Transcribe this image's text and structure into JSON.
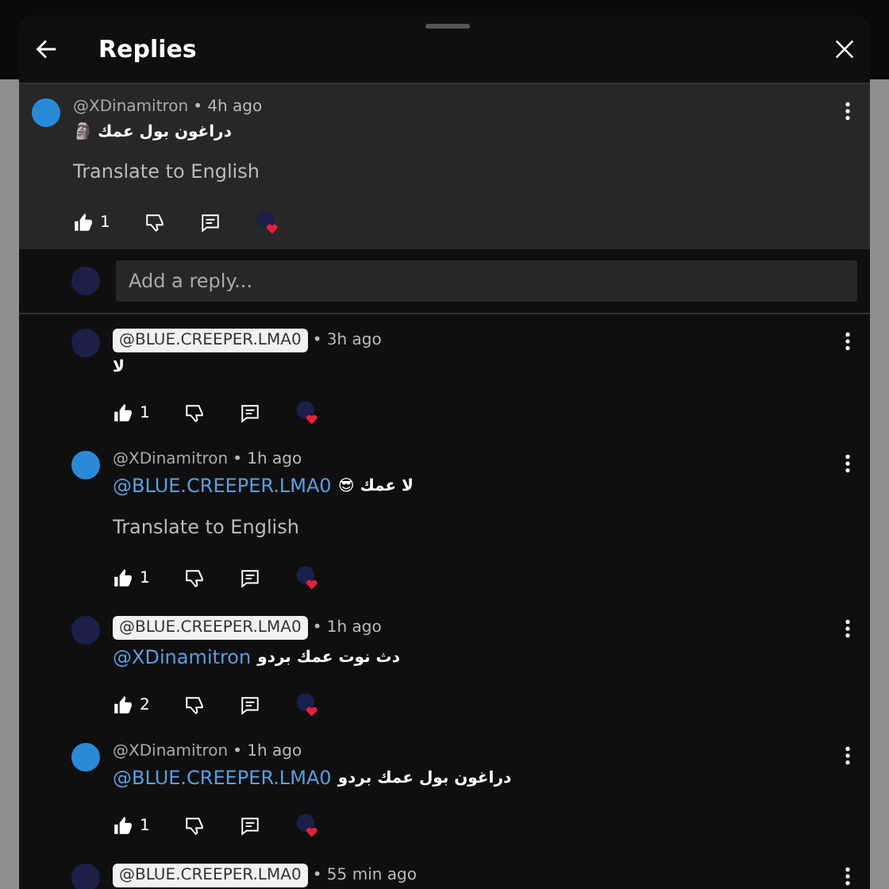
{
  "header": {
    "title": "Replies"
  },
  "parent_comment": {
    "author": "@XDinamitron",
    "author_highlighted": false,
    "time": "• 4h ago",
    "color": "#2a8ad8",
    "text": "دراغون بول عمك 🗿",
    "translate": "Translate to English",
    "likes": "1",
    "hearted": true
  },
  "reply_box": {
    "placeholder": "Add a reply..."
  },
  "replies": [
    {
      "author": "@BLUE.CREEPER.LMA0",
      "author_highlighted": true,
      "time": "• 3h ago",
      "color": "#1c2048",
      "text": "لا",
      "likes": "1",
      "hearted": true
    },
    {
      "author": "@XDinamitron",
      "author_highlighted": false,
      "time": "• 1h ago",
      "color": "#2a8ad8",
      "mention": "@BLUE.CREEPER.LMA0",
      "text": "لا عمك 😎",
      "translate": "Translate to English",
      "likes": "1",
      "hearted": true
    },
    {
      "author": "@BLUE.CREEPER.LMA0",
      "author_highlighted": true,
      "time": "• 1h ago",
      "color": "#1c2048",
      "mention": "@XDinamitron",
      "text": "دث نوت عمك بردو",
      "likes": "2",
      "hearted": true
    },
    {
      "author": "@XDinamitron",
      "author_highlighted": false,
      "time": "• 1h ago",
      "color": "#2a8ad8",
      "mention": "@BLUE.CREEPER.LMA0",
      "text": "دراغون بول عمك بردو",
      "likes": "1",
      "hearted": true
    },
    {
      "author": "@BLUE.CREEPER.LMA0",
      "author_highlighted": true,
      "time": "• 55 min ago",
      "color": "#1c2048"
    }
  ]
}
